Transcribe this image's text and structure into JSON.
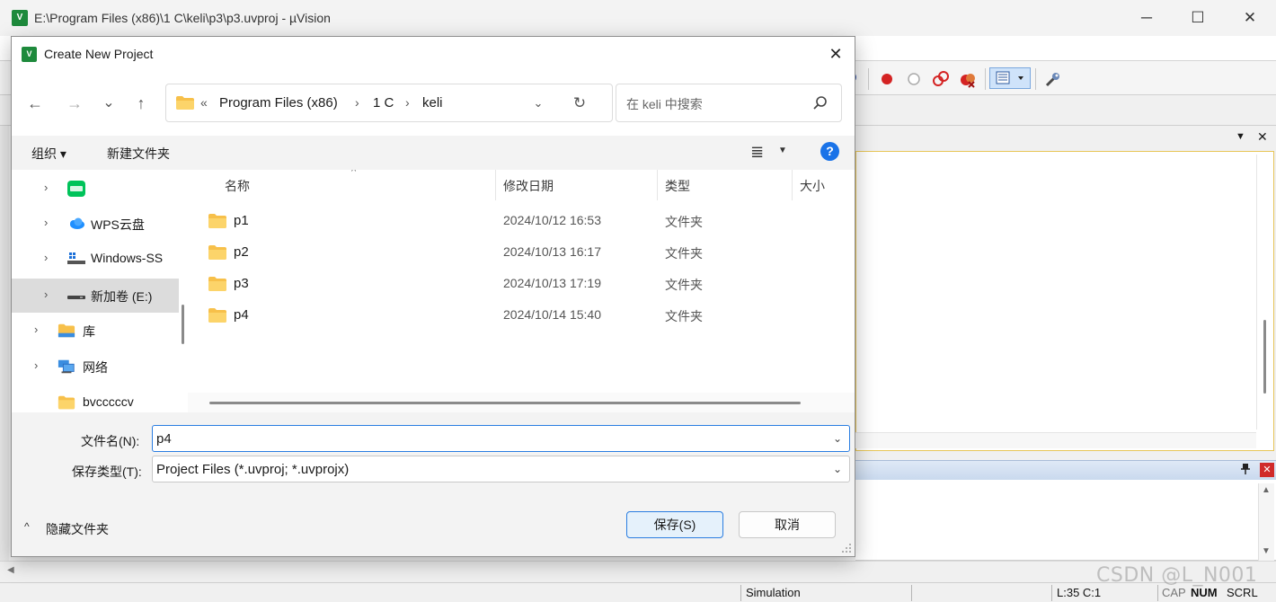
{
  "ide": {
    "logo_text": "V",
    "title": "E:\\Program Files (x86)\\1 C\\keli\\p3\\p3.uvproj - µVision",
    "window_controls": {
      "minimize": "─",
      "maximize": "☐",
      "close": "✕"
    },
    "panel_controls": {
      "dropdown": "▼",
      "close": "✕"
    },
    "bottom_panel_controls": {
      "pin": "📌",
      "close": "✕"
    },
    "status": {
      "mode": "Simulation",
      "cursor": "L:35 C:1",
      "cap": "CAP",
      "num": "NUM",
      "scrl": "SCRL"
    },
    "watermark": "CSDN @L_N001"
  },
  "dialog": {
    "logo_text": "V",
    "title": "Create New Project",
    "close_glyph": "✕",
    "nav": {
      "back": "←",
      "forward": "→",
      "recent": "⌄",
      "up": "↑"
    },
    "address": {
      "prefix": "«",
      "segments": [
        "Program Files (x86)",
        "1 C",
        "keli"
      ],
      "separator": "›",
      "dropdown_glyph": "⌄",
      "refresh_glyph": "↻"
    },
    "search": {
      "placeholder": "在 keli 中搜索"
    },
    "commands": {
      "organize": "组织 ▾",
      "new_folder": "新建文件夹",
      "view_glyph": "≣",
      "view_dropdown": "▼",
      "help": "?"
    },
    "nav_pane": [
      {
        "label": "",
        "icon": "iqiyi-icon",
        "expandable": true,
        "selected": false
      },
      {
        "label": "WPS云盘",
        "icon": "cloud-icon",
        "expandable": true,
        "selected": false
      },
      {
        "label": "Windows-SS",
        "icon": "windows-drive-icon",
        "expandable": true,
        "selected": false
      },
      {
        "label": "新加卷 (E:)",
        "icon": "drive-icon",
        "expandable": true,
        "selected": true
      },
      {
        "label": "库",
        "icon": "library-folder-icon",
        "expandable": true,
        "selected": false
      },
      {
        "label": "网络",
        "icon": "network-icon",
        "expandable": true,
        "selected": false
      },
      {
        "label": "bvcccccv",
        "icon": "folder-icon",
        "expandable": false,
        "selected": false
      }
    ],
    "columns": {
      "name": "名称",
      "modified": "修改日期",
      "type": "类型",
      "size": "大小"
    },
    "sort_glyph": "^",
    "files": [
      {
        "name": "p1",
        "modified": "2024/10/12 16:53",
        "type": "文件夹"
      },
      {
        "name": "p2",
        "modified": "2024/10/13 16:17",
        "type": "文件夹"
      },
      {
        "name": "p3",
        "modified": "2024/10/13 17:19",
        "type": "文件夹"
      },
      {
        "name": "p4",
        "modified": "2024/10/14 15:40",
        "type": "文件夹"
      }
    ],
    "filename": {
      "label": "文件名(N):",
      "value": "p4"
    },
    "filetype": {
      "label": "保存类型(T):",
      "value": "Project Files (*.uvproj; *.uvprojx)"
    },
    "dropdown_glyph": "⌄",
    "hide_folders": {
      "chevron": "^",
      "label": "隐藏文件夹"
    },
    "buttons": {
      "save": "保存(S)",
      "cancel": "取消"
    }
  },
  "colors": {
    "accent": "#2a7de1",
    "folder": "#f7c04a",
    "keil_green": "#1e8a3c",
    "help_blue": "#1a73e8"
  }
}
